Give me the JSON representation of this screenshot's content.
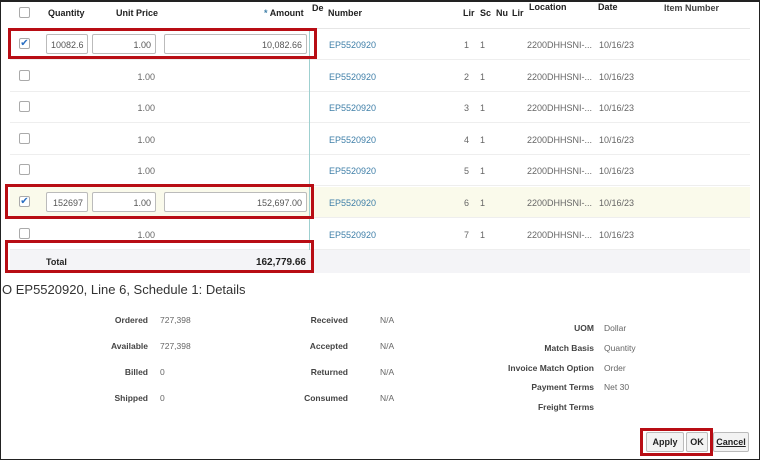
{
  "columns": {
    "quantity": "Quantity",
    "unit_price": "Unit Price",
    "amount_req": "*",
    "amount": "Amount",
    "de": "De",
    "number": "Number",
    "line": "Lir",
    "schedule": "Sc",
    "num": "Nu",
    "lir2": "Lir",
    "location": "Location",
    "date": "Date",
    "item_number": "Item Number"
  },
  "rows": [
    {
      "checked": true,
      "quantity": "10082.6",
      "unit_price": "1.00",
      "amount": "10,082.66",
      "number": "EP5520920",
      "line": "1",
      "schedule": "1",
      "location": "2200DHHSNI-...",
      "date": "10/16/23"
    },
    {
      "checked": false,
      "unit_price": "1.00",
      "number": "EP5520920",
      "line": "2",
      "schedule": "1",
      "location": "2200DHHSNI-...",
      "date": "10/16/23"
    },
    {
      "checked": false,
      "unit_price": "1.00",
      "number": "EP5520920",
      "line": "3",
      "schedule": "1",
      "location": "2200DHHSNI-...",
      "date": "10/16/23"
    },
    {
      "checked": false,
      "unit_price": "1.00",
      "number": "EP5520920",
      "line": "4",
      "schedule": "1",
      "location": "2200DHHSNI-...",
      "date": "10/16/23"
    },
    {
      "checked": false,
      "unit_price": "1.00",
      "number": "EP5520920",
      "line": "5",
      "schedule": "1",
      "location": "2200DHHSNI-...",
      "date": "10/16/23"
    },
    {
      "checked": true,
      "quantity": "152697",
      "unit_price": "1.00",
      "amount": "152,697.00",
      "number": "EP5520920",
      "line": "6",
      "schedule": "1",
      "location": "2200DHHSNI-...",
      "date": "10/16/23"
    },
    {
      "checked": false,
      "unit_price": "1.00",
      "number": "EP5520920",
      "line": "7",
      "schedule": "1",
      "location": "2200DHHSNI-...",
      "date": "10/16/23"
    }
  ],
  "total": {
    "label": "Total",
    "value": "162,779.66"
  },
  "details": {
    "title": "O EP5520920, Line 6, Schedule 1: Details",
    "col1": [
      {
        "label": "Ordered",
        "value": "727,398"
      },
      {
        "label": "Available",
        "value": "727,398"
      },
      {
        "label": "Billed",
        "value": "0"
      },
      {
        "label": "Shipped",
        "value": "0"
      }
    ],
    "col2": [
      {
        "label": "Received",
        "value": "N/A"
      },
      {
        "label": "Accepted",
        "value": "N/A"
      },
      {
        "label": "Returned",
        "value": "N/A"
      },
      {
        "label": "Consumed",
        "value": "N/A"
      }
    ],
    "col3": [
      {
        "label": "UOM",
        "value": "Dollar"
      },
      {
        "label": "Match Basis",
        "value": "Quantity"
      },
      {
        "label": "Invoice Match Option",
        "value": "Order"
      },
      {
        "label": "Payment Terms",
        "value": "Net 30"
      },
      {
        "label": "Freight Terms",
        "value": ""
      }
    ]
  },
  "buttons": {
    "apply": "Apply",
    "ok": "OK",
    "cancel": "Cancel"
  },
  "colors": {
    "highlight": "#b80d14",
    "link": "#3f7fa8"
  }
}
